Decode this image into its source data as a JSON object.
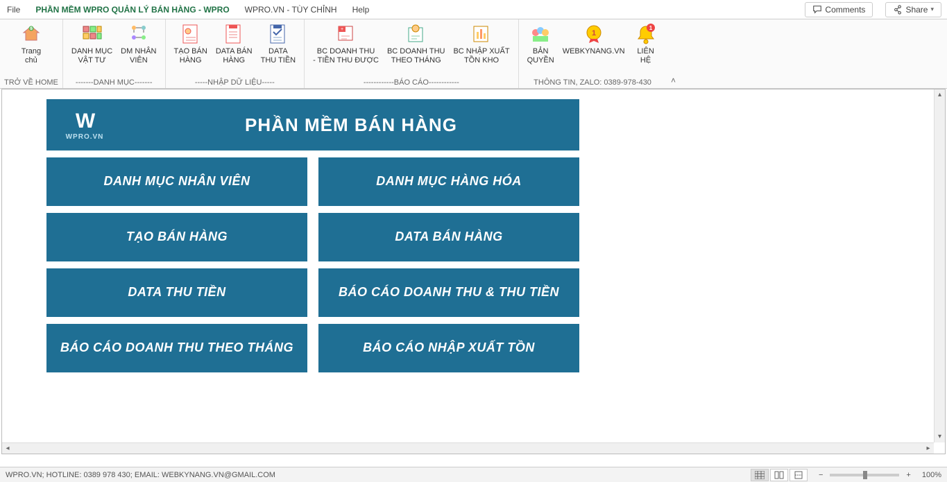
{
  "menubar": {
    "file": "File",
    "tab_main": "PHẦN MỀM WPRO QUẢN LÝ BÁN HÀNG - WPRO",
    "tab_custom": "WPRO.VN - TÙY CHỈNH",
    "help": "Help",
    "comments": "Comments",
    "share": "Share"
  },
  "ribbon": {
    "group_home": {
      "label": "TRỞ VỀ HOME",
      "btn_home_l1": "Trang",
      "btn_home_l2": "chủ"
    },
    "group_danhmuc": {
      "label": "-------DANH MỤC-------",
      "btn_vattu_l1": "DANH MỤC",
      "btn_vattu_l2": "VẬT TƯ",
      "btn_nhanvien_l1": "DM NHÂN",
      "btn_nhanvien_l2": "VIÊN"
    },
    "group_nhap": {
      "label": "-----NHẬP DỮ LIỆU-----",
      "btn_taoban_l1": "TẠO BÁN",
      "btn_taoban_l2": "HÀNG",
      "btn_databan_l1": "DATA BÁN",
      "btn_databan_l2": "HÀNG",
      "btn_datathu_l1": "DATA",
      "btn_datathu_l2": "THU TIỀN"
    },
    "group_baocao": {
      "label": "------------BÁO CÁO------------",
      "btn_bcdt_l1": "BC DOANH THU",
      "btn_bcdt_l2": "- TIỀN THU ĐƯỢC",
      "btn_bcthang_l1": "BC DOANH THU",
      "btn_bcthang_l2": "THEO THÁNG",
      "btn_bcnxt_l1": "BC NHẬP XUẤT",
      "btn_bcnxt_l2": "TỒN KHO"
    },
    "group_info": {
      "label": "THÔNG TIN, ZALO: 0389-978-430",
      "btn_banquyen_l1": "BẢN",
      "btn_banquyen_l2": "QUYỀN",
      "btn_web": "WEBKYNANG.VN",
      "btn_lienhe_l1": "LIÊN",
      "btn_lienhe_l2": "HỆ"
    }
  },
  "sheet": {
    "logo_sub": "WPRO.VN",
    "banner_title": "PHẦN MỀM BÁN HÀNG",
    "tiles": {
      "t1": "DANH MỤC NHÂN VIÊN",
      "t2": "DANH MỤC HÀNG HÓA",
      "t3": "TẠO BÁN HÀNG",
      "t4": "DATA BÁN HÀNG",
      "t5": "DATA THU TIỀN",
      "t6": "BÁO CÁO DOANH THU & THU TIỀN",
      "t7": "BÁO CÁO DOANH THU THEO THÁNG",
      "t8": "BÁO CÁO NHẬP XUẤT TỒN"
    }
  },
  "status": {
    "text": "WPRO.VN; HOTLINE: 0389 978 430; EMAIL: WEBKYNANG.VN@GMAIL.COM",
    "zoom": "100%"
  }
}
